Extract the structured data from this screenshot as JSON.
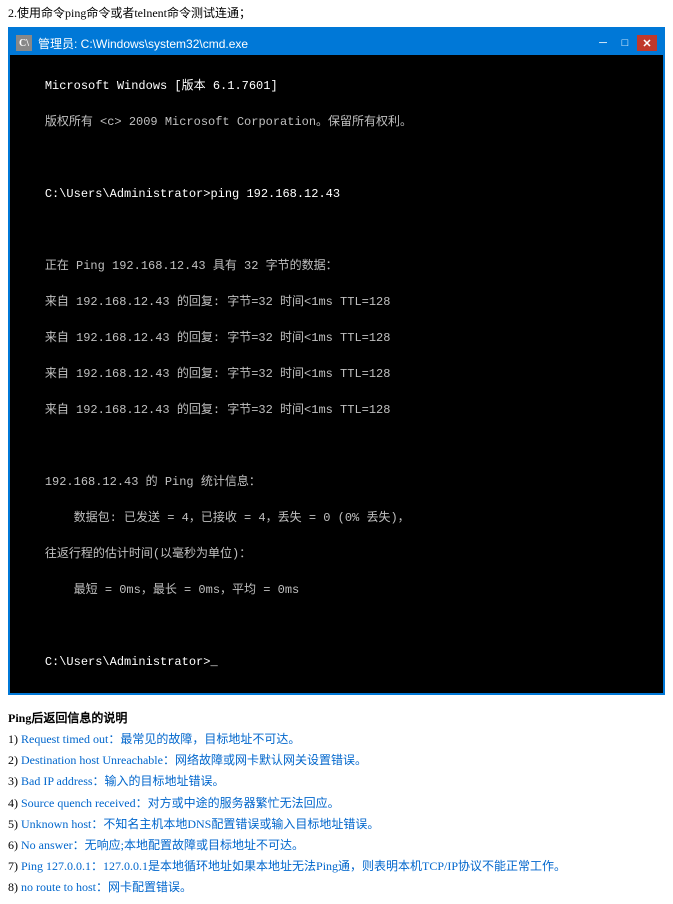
{
  "top": {
    "instruction": "2.使用命令ping命令或者telnent命令测试连通；"
  },
  "cmd": {
    "title": "管理员: C:\\Windows\\system32\\cmd.exe",
    "titlebar_icon": "C:\\",
    "content_lines": [
      "Microsoft Windows [版本 6.1.7601]",
      "版权所有 <c> 2009 Microsoft Corporation。保留所有权利。",
      "",
      "C:\\Users\\Administrator>ping 192.168.12.43",
      "",
      "正在 Ping 192.168.12.43 具有 32 字节的数据：",
      "来自 192.168.12.43 的回复: 字节=32 时间<1ms TTL=128",
      "来自 192.168.12.43 的回复: 字节=32 时间<1ms TTL=128",
      "来自 192.168.12.43 的回复: 字节=32 时间<1ms TTL=128",
      "来自 192.168.12.43 的回复: 字节=32 时间<1ms TTL=128",
      "",
      "192.168.12.43 的 Ping 统计信息：",
      "    数据包: 已发送 = 4，已接收 = 4，丢失 = 0 (0% 丢失)，",
      "往返行程的估计时间(以毫秒为单位)：",
      "    最短 = 0ms，最长 = 0ms，平均 = 0ms",
      "",
      "C:\\Users\\Administrator>_"
    ],
    "buttons": {
      "minimize": "─",
      "maximize": "□",
      "close": "✕"
    }
  },
  "ping_info": {
    "title": "Ping后返回信息的说明",
    "items": [
      {
        "num": "1)",
        "label": "Request timed out",
        "sep": "：",
        "desc": "最常见的故障，目标地址不可达。"
      },
      {
        "num": "2)",
        "label": "Destination host Unreachable",
        "sep": "：",
        "desc": "网络故障或网卡默认网关设置错误。"
      },
      {
        "num": "3)",
        "label": "Bad IP address",
        "sep": "：",
        "desc": "输入的目标地址错误。"
      },
      {
        "num": "4)",
        "label": "Source quench received",
        "sep": "：",
        "desc": "对方或中途的服务器繁忙无法回应。"
      },
      {
        "num": "5)",
        "label": "Unknown host",
        "sep": "：",
        "desc": "不知名主机本地DNS配置错误或输入目标地址错误。"
      },
      {
        "num": "6)",
        "label": "No answer",
        "sep": "：无响应;本地配置故障或目标地址不可达。"
      },
      {
        "num": "7)",
        "label": "Ping 127.0.0.1",
        "sep": "：",
        "desc": "127.0.0.1是本地循环地址如果本地址无法Ping通，则表明本机TCP/IP协议不能正常工作。"
      },
      {
        "num": "8)",
        "label": "no route to host",
        "sep": "：",
        "desc": "网卡配置错误。"
      }
    ]
  }
}
